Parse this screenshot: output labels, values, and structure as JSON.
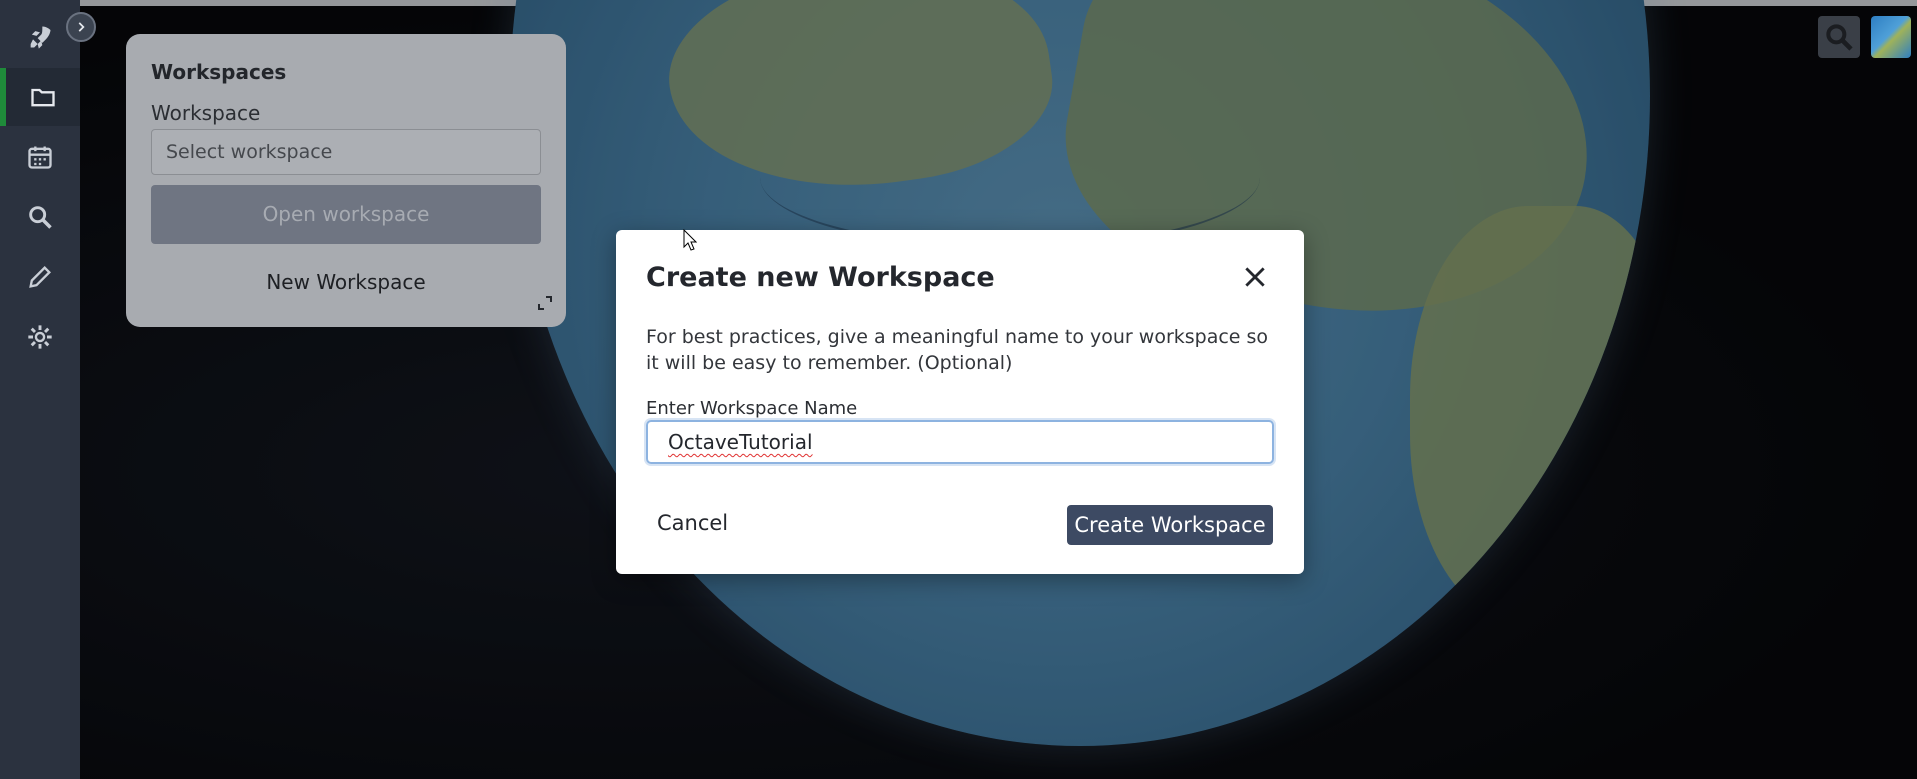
{
  "sidebar": {
    "expand_icon": "chevron-right-icon",
    "items": [
      {
        "icon": "rocket-icon",
        "active": false
      },
      {
        "icon": "folder-icon",
        "active": true
      },
      {
        "icon": "calendar-icon",
        "active": false
      },
      {
        "icon": "search-icon",
        "active": false
      },
      {
        "icon": "pencil-icon",
        "active": false
      },
      {
        "icon": "gear-icon",
        "active": false
      }
    ],
    "active_color": "#1f8b3a"
  },
  "workspaces_panel": {
    "title": "Workspaces",
    "workspace_label": "Workspace",
    "select_placeholder": "Select workspace",
    "open_button": "Open workspace",
    "new_workspace_link": "New Workspace"
  },
  "toolbar": {
    "search_icon": "search-icon",
    "layer_icon": "map-layer-icon"
  },
  "modal": {
    "title": "Create new Workspace",
    "description": "For best practices, give a meaningful name to your workspace so it will be easy to remember. (Optional)",
    "name_label": "Enter Workspace Name",
    "name_value": "OctaveTutorial",
    "cancel_button": "Cancel",
    "create_button": "Create Workspace",
    "accent": "#3d4a63"
  }
}
